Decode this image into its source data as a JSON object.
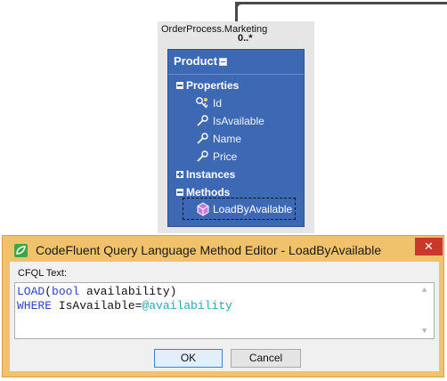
{
  "diagram": {
    "namespace": "OrderProcess.Marketing",
    "multiplicity": "0..*",
    "entity": {
      "title": "Product",
      "sections": {
        "properties": {
          "label": "Properties",
          "state": "expanded"
        },
        "instances": {
          "label": "Instances",
          "state": "collapsed"
        },
        "methods": {
          "label": "Methods",
          "state": "expanded"
        }
      },
      "properties": [
        {
          "name": "Id",
          "icon": "key-property-icon"
        },
        {
          "name": "IsAvailable",
          "icon": "property-icon"
        },
        {
          "name": "Name",
          "icon": "property-icon"
        },
        {
          "name": "Price",
          "icon": "property-icon"
        }
      ],
      "methods": [
        {
          "name": "LoadByAvailable",
          "icon": "method-cube-icon"
        }
      ]
    }
  },
  "dialog": {
    "title": "CodeFluent Query Language Method Editor - LoadByAvailable",
    "close_glyph": "✕",
    "cfql_label": "CFQL Text:",
    "code": {
      "line1": {
        "keyword": "LOAD",
        "open": "(",
        "type": "bool",
        "rest": " availability)"
      },
      "line2": {
        "keyword": "WHERE",
        "text": " IsAvailable=",
        "param": "@availability"
      }
    },
    "ok_label": "OK",
    "cancel_label": "Cancel"
  },
  "colors": {
    "entity_blue": "#3d68b3",
    "keyword_blue": "#2b45c8",
    "param_teal": "#2aa6b7",
    "dialog_frame": "#f1c26c",
    "close_red": "#c8382b"
  }
}
